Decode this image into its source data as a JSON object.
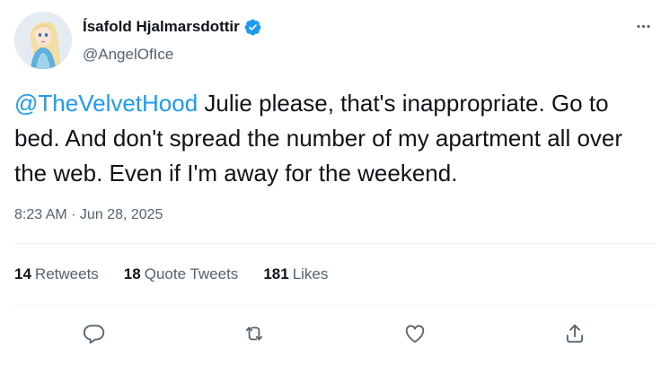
{
  "author": {
    "display_name": "Ísafold Hjalmarsdottir",
    "handle": "@AngelOfIce",
    "verified_icon": "verified-badge-icon",
    "avatar_icon": "avatar-ice-princess-illustration"
  },
  "tweet": {
    "mention": "@TheVelvetHood",
    "text": " Julie please, that's inappropriate. Go to bed. And don't spread the number of my apartment all over the web. Even if I'm away for the weekend.",
    "timestamp": "8:23 AM · Jun 28, 2025"
  },
  "stats": {
    "retweets": {
      "count": "14",
      "label": "Retweets"
    },
    "quote_tweets": {
      "count": "18",
      "label": "Quote Tweets"
    },
    "likes": {
      "count": "181",
      "label": "Likes"
    }
  },
  "actions": [
    "reply-icon",
    "retweet-icon",
    "like-icon",
    "share-icon"
  ],
  "colors": {
    "accent": "#1d9bf0",
    "text": "#0f1419",
    "secondary": "#536471",
    "divider": "#eff3f4"
  }
}
